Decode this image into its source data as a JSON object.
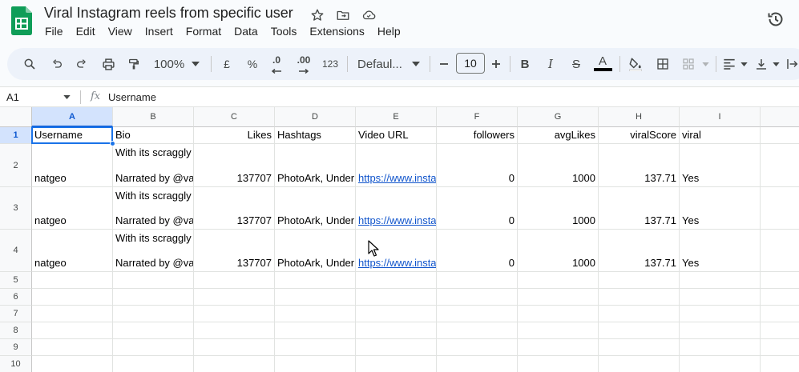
{
  "document": {
    "title": "Viral Instagram reels from specific user"
  },
  "menu": [
    "File",
    "Edit",
    "View",
    "Insert",
    "Format",
    "Data",
    "Tools",
    "Extensions",
    "Help"
  ],
  "toolbar": {
    "zoom": "100%",
    "currency": "£",
    "percent": "%",
    "decrease_decimal": ".0",
    "increase_decimal": ".00",
    "number_format": "123",
    "font": "Defaul...",
    "font_size": "10",
    "bold": "B",
    "italic": "I",
    "strike": "S",
    "text_color": "A"
  },
  "formula_bar": {
    "name_box": "A1",
    "fx": "fx",
    "value": "Username"
  },
  "grid": {
    "columns": [
      "A",
      "B",
      "C",
      "D",
      "E",
      "F",
      "G",
      "H",
      "I"
    ],
    "rows": [
      "1",
      "2",
      "3",
      "4",
      "5",
      "6",
      "7",
      "8",
      "9",
      "10"
    ],
    "header": [
      "Username",
      "Bio",
      "Likes",
      "Hashtags",
      "Video URL",
      "followers",
      "avgLikes",
      "viralScore",
      "viral"
    ],
    "data": [
      {
        "username": "natgeo",
        "bio_line1": "With its scraggly",
        "bio_line2": "Narrated by @va",
        "likes": "137707",
        "hashtags": "PhotoArk, Under",
        "url": "https://www.insta",
        "followers": "0",
        "avgLikes": "1000",
        "viralScore": "137.71",
        "viral": "Yes"
      },
      {
        "username": "natgeo",
        "bio_line1": "With its scraggly",
        "bio_line2": "Narrated by @va",
        "likes": "137707",
        "hashtags": "PhotoArk, Under",
        "url": "https://www.insta",
        "followers": "0",
        "avgLikes": "1000",
        "viralScore": "137.71",
        "viral": "Yes"
      },
      {
        "username": "natgeo",
        "bio_line1": "With its scraggly",
        "bio_line2": "Narrated by @va",
        "likes": "137707",
        "hashtags": "PhotoArk, Under",
        "url": "https://www.insta",
        "followers": "0",
        "avgLikes": "1000",
        "viralScore": "137.71",
        "viral": "Yes"
      }
    ]
  },
  "colors": {
    "accent": "#1a73e8",
    "sheets_green": "#0f9d58",
    "link": "#1155cc",
    "toolbar_bg": "#edf2fa"
  }
}
